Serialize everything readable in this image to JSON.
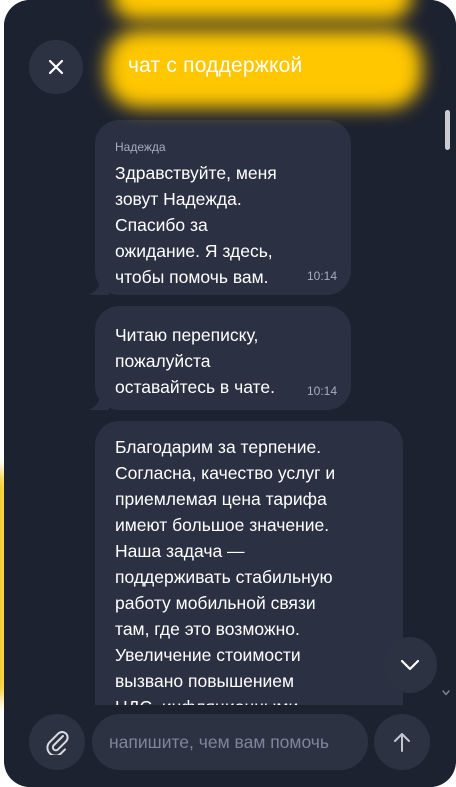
{
  "header": {
    "title": "чат с поддержкой",
    "close_icon": "close-icon"
  },
  "messages": [
    {
      "sender": "Надежда",
      "lines": [
        "Здравствуйте, меня",
        "зовут Надежда.",
        "Спасибо за",
        "ожидание. Я здесь,",
        "чтобы помочь вам."
      ],
      "time": "10:14"
    },
    {
      "lines": [
        "Читаю переписку,",
        "пожалуйста",
        "оставайтесь в чате."
      ],
      "time": "10:14"
    },
    {
      "lines": [
        "Благодарим за терпение.",
        "Согласна, качество услуг и",
        "приемлемая цена тарифа",
        "имеют большое значение.",
        "Наша задача —",
        "поддерживать стабильную",
        "работу мобильной связи",
        "там, где это возможно.",
        "Увеличение стоимости",
        "вызвано повышением",
        "НДС, инфляционными"
      ]
    }
  ],
  "composer": {
    "placeholder": "напишите, чем вам помочь",
    "attach_icon": "paperclip-icon",
    "send_icon": "arrow-up-icon"
  },
  "icons": {
    "scroll_down": "chevron-down-icon"
  },
  "colors": {
    "background": "#1d2230",
    "bubble": "#2b3142",
    "button": "#2c3242",
    "accent": "#ffc700",
    "text": "#ffffff",
    "muted_text": "#a7adbb"
  }
}
